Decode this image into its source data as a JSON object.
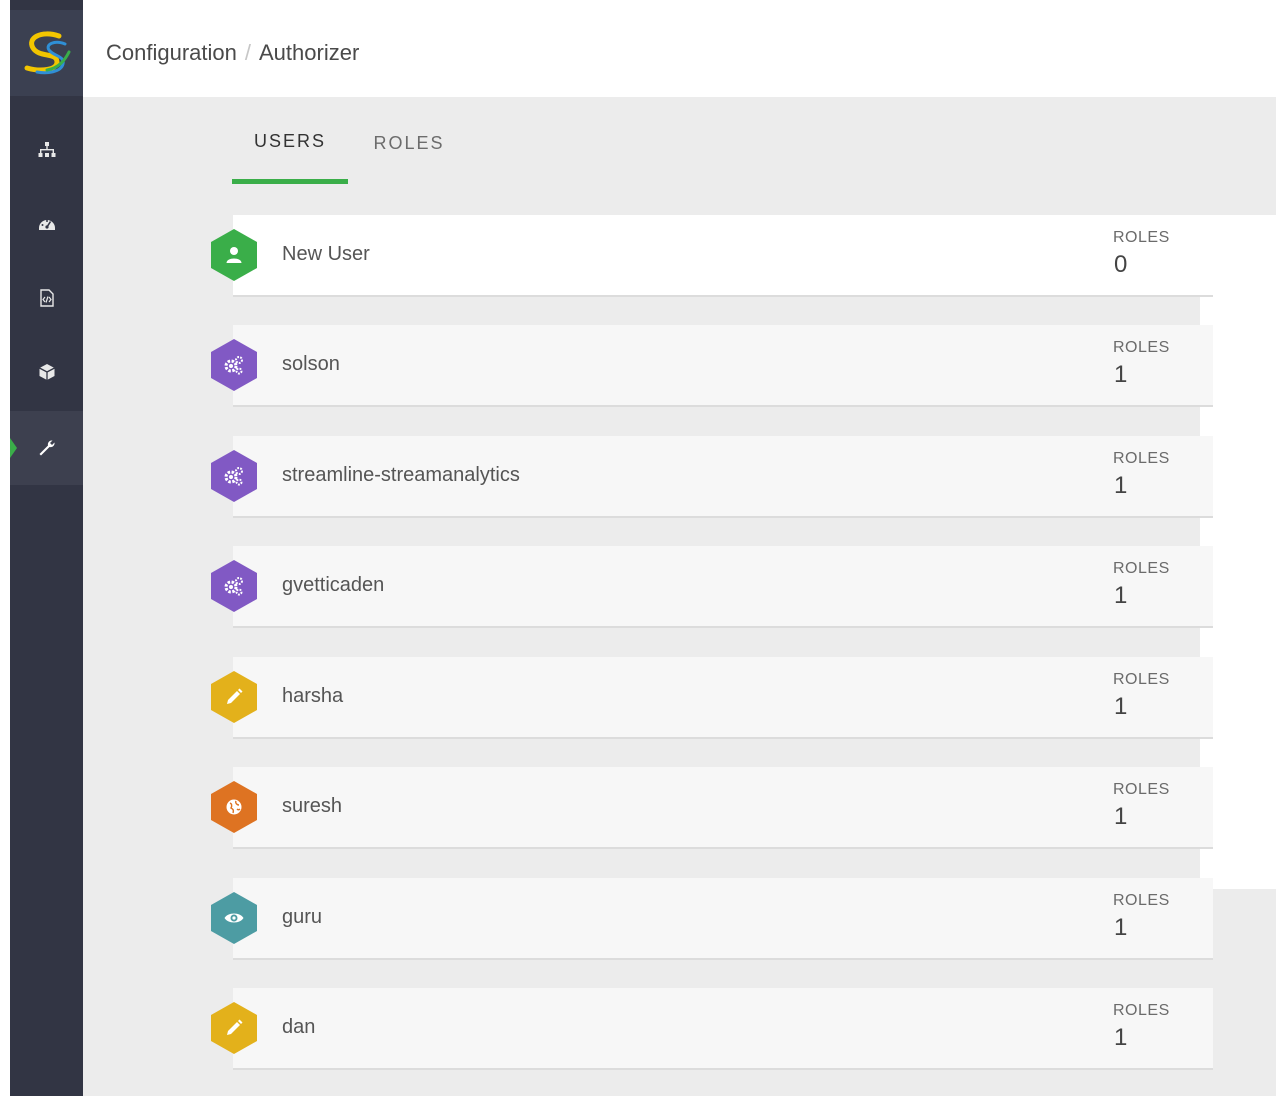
{
  "header": {
    "breadcrumb": [
      "Configuration",
      "Authorizer"
    ],
    "separator": "/"
  },
  "sidebar": {
    "logo": "streamline-logo",
    "items": [
      {
        "icon": "sitemap-icon",
        "active": false
      },
      {
        "icon": "dashboard-icon",
        "active": false
      },
      {
        "icon": "code-file-icon",
        "active": false
      },
      {
        "icon": "cube-icon",
        "active": false
      },
      {
        "icon": "wrench-icon",
        "active": true
      }
    ]
  },
  "tabs": [
    {
      "label": "USERS",
      "active": true
    },
    {
      "label": "ROLES",
      "active": false
    }
  ],
  "users": [
    {
      "name": "New User",
      "roles_label": "ROLES",
      "roles": "0",
      "icon": "user-icon",
      "color": "#3aae49"
    },
    {
      "name": "solson",
      "roles_label": "ROLES",
      "roles": "1",
      "icon": "gears-icon",
      "color": "#8159c4"
    },
    {
      "name": "streamline-streamanalytics",
      "roles_label": "ROLES",
      "roles": "1",
      "icon": "gears-icon",
      "color": "#8159c4"
    },
    {
      "name": "gvetticaden",
      "roles_label": "ROLES",
      "roles": "1",
      "icon": "gears-icon",
      "color": "#8159c4"
    },
    {
      "name": "harsha",
      "roles_label": "ROLES",
      "roles": "1",
      "icon": "pencil-icon",
      "color": "#e3b11b"
    },
    {
      "name": "suresh",
      "roles_label": "ROLES",
      "roles": "1",
      "icon": "globe-icon",
      "color": "#de7322"
    },
    {
      "name": "guru",
      "roles_label": "ROLES",
      "roles": "1",
      "icon": "eye-icon",
      "color": "#4d9ca3"
    },
    {
      "name": "dan",
      "roles_label": "ROLES",
      "roles": "1",
      "icon": "pencil-icon",
      "color": "#e3b11b"
    }
  ]
}
